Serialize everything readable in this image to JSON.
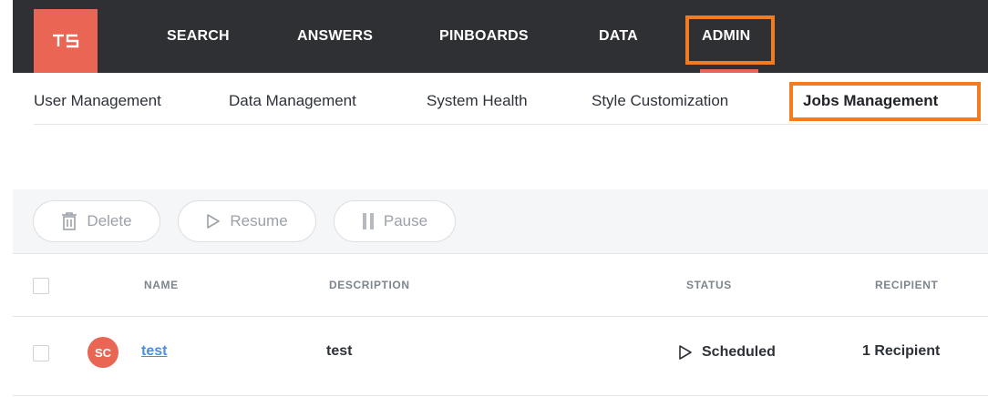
{
  "app": {
    "logo": "ts-logo",
    "brand_color": "#ea6654",
    "highlight_color": "#f47c20"
  },
  "topnav": {
    "items": [
      {
        "label": "SEARCH"
      },
      {
        "label": "ANSWERS"
      },
      {
        "label": "PINBOARDS"
      },
      {
        "label": "DATA"
      },
      {
        "label": "ADMIN",
        "active": true
      }
    ]
  },
  "subnav": {
    "items": [
      {
        "label": "User Management"
      },
      {
        "label": "Data Management"
      },
      {
        "label": "System Health"
      },
      {
        "label": "Style Customization"
      },
      {
        "label": "Jobs Management",
        "active": true
      }
    ]
  },
  "toolbar": {
    "delete_label": "Delete",
    "delete_icon": "trash-icon",
    "resume_label": "Resume",
    "resume_icon": "play-outline-icon",
    "pause_label": "Pause",
    "pause_icon": "pause-icon"
  },
  "table": {
    "columns": [
      "NAME",
      "DESCRIPTION",
      "STATUS",
      "RECIPIENT"
    ],
    "rows": [
      {
        "avatar_initials": "SC",
        "name": "test",
        "description": "test",
        "status": "Scheduled",
        "status_icon": "play-outline-icon",
        "recipient": "1 Recipient"
      }
    ]
  }
}
